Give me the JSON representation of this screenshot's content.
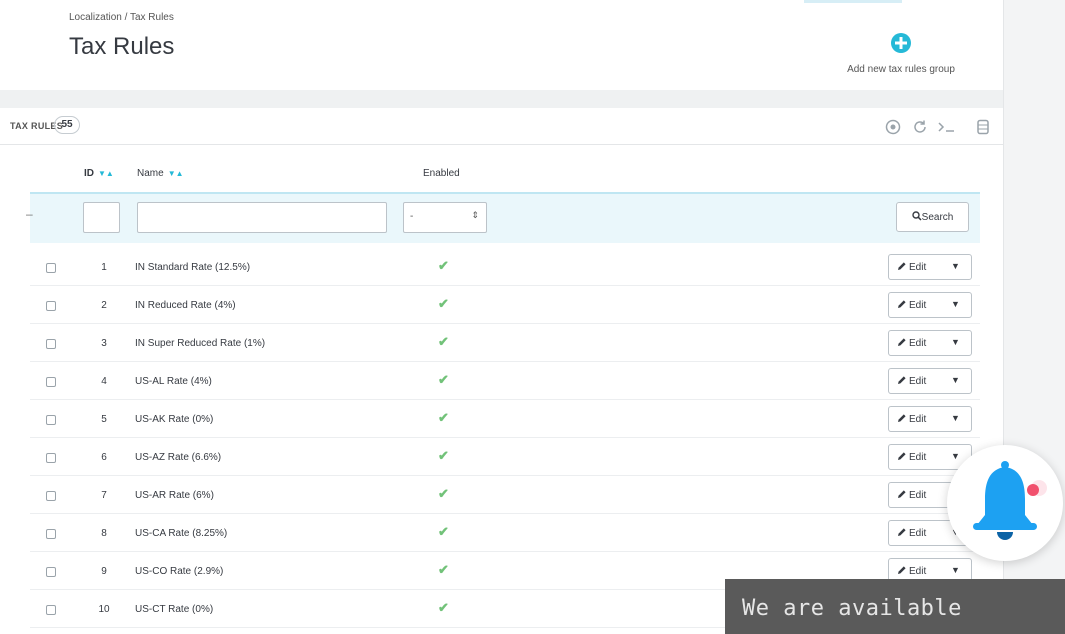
{
  "breadcrumb": "Localization  /  Tax Rules",
  "page_title": "Tax Rules",
  "toolbar": {
    "add_group_label": "Add new tax rules group"
  },
  "panel": {
    "title": "TAX RULES",
    "count": "55"
  },
  "columns": {
    "id": "ID",
    "name": "Name",
    "enabled": "Enabled"
  },
  "filters": {
    "enabled_value": "-",
    "search_label": "Search"
  },
  "rows": [
    {
      "id": "1",
      "name": "IN Standard Rate (12.5%)",
      "edit": "Edit"
    },
    {
      "id": "2",
      "name": "IN Reduced Rate (4%)",
      "edit": "Edit"
    },
    {
      "id": "3",
      "name": "IN Super Reduced Rate (1%)",
      "edit": "Edit"
    },
    {
      "id": "4",
      "name": "US-AL Rate (4%)",
      "edit": "Edit"
    },
    {
      "id": "5",
      "name": "US-AK Rate (0%)",
      "edit": "Edit"
    },
    {
      "id": "6",
      "name": "US-AZ Rate (6.6%)",
      "edit": "Edit"
    },
    {
      "id": "7",
      "name": "US-AR Rate (6%)",
      "edit": "Edit"
    },
    {
      "id": "8",
      "name": "US-CA Rate (8.25%)",
      "edit": "Edit"
    },
    {
      "id": "9",
      "name": "US-CO Rate (2.9%)",
      "edit": "Edit"
    },
    {
      "id": "10",
      "name": "US-CT Rate (0%)",
      "edit": "Edit"
    }
  ],
  "chat": {
    "label": "We are available"
  },
  "colors": {
    "accent": "#25b9d7",
    "check": "#72c279",
    "bell": "#1da1f2",
    "notification_dot": "#f1506d"
  },
  "icons": {
    "add": "plus-circle-icon",
    "refresh": "refresh-icon",
    "sql": "terminal-icon",
    "export": "database-icon",
    "edit": "pencil-icon",
    "bell": "bell-icon"
  }
}
